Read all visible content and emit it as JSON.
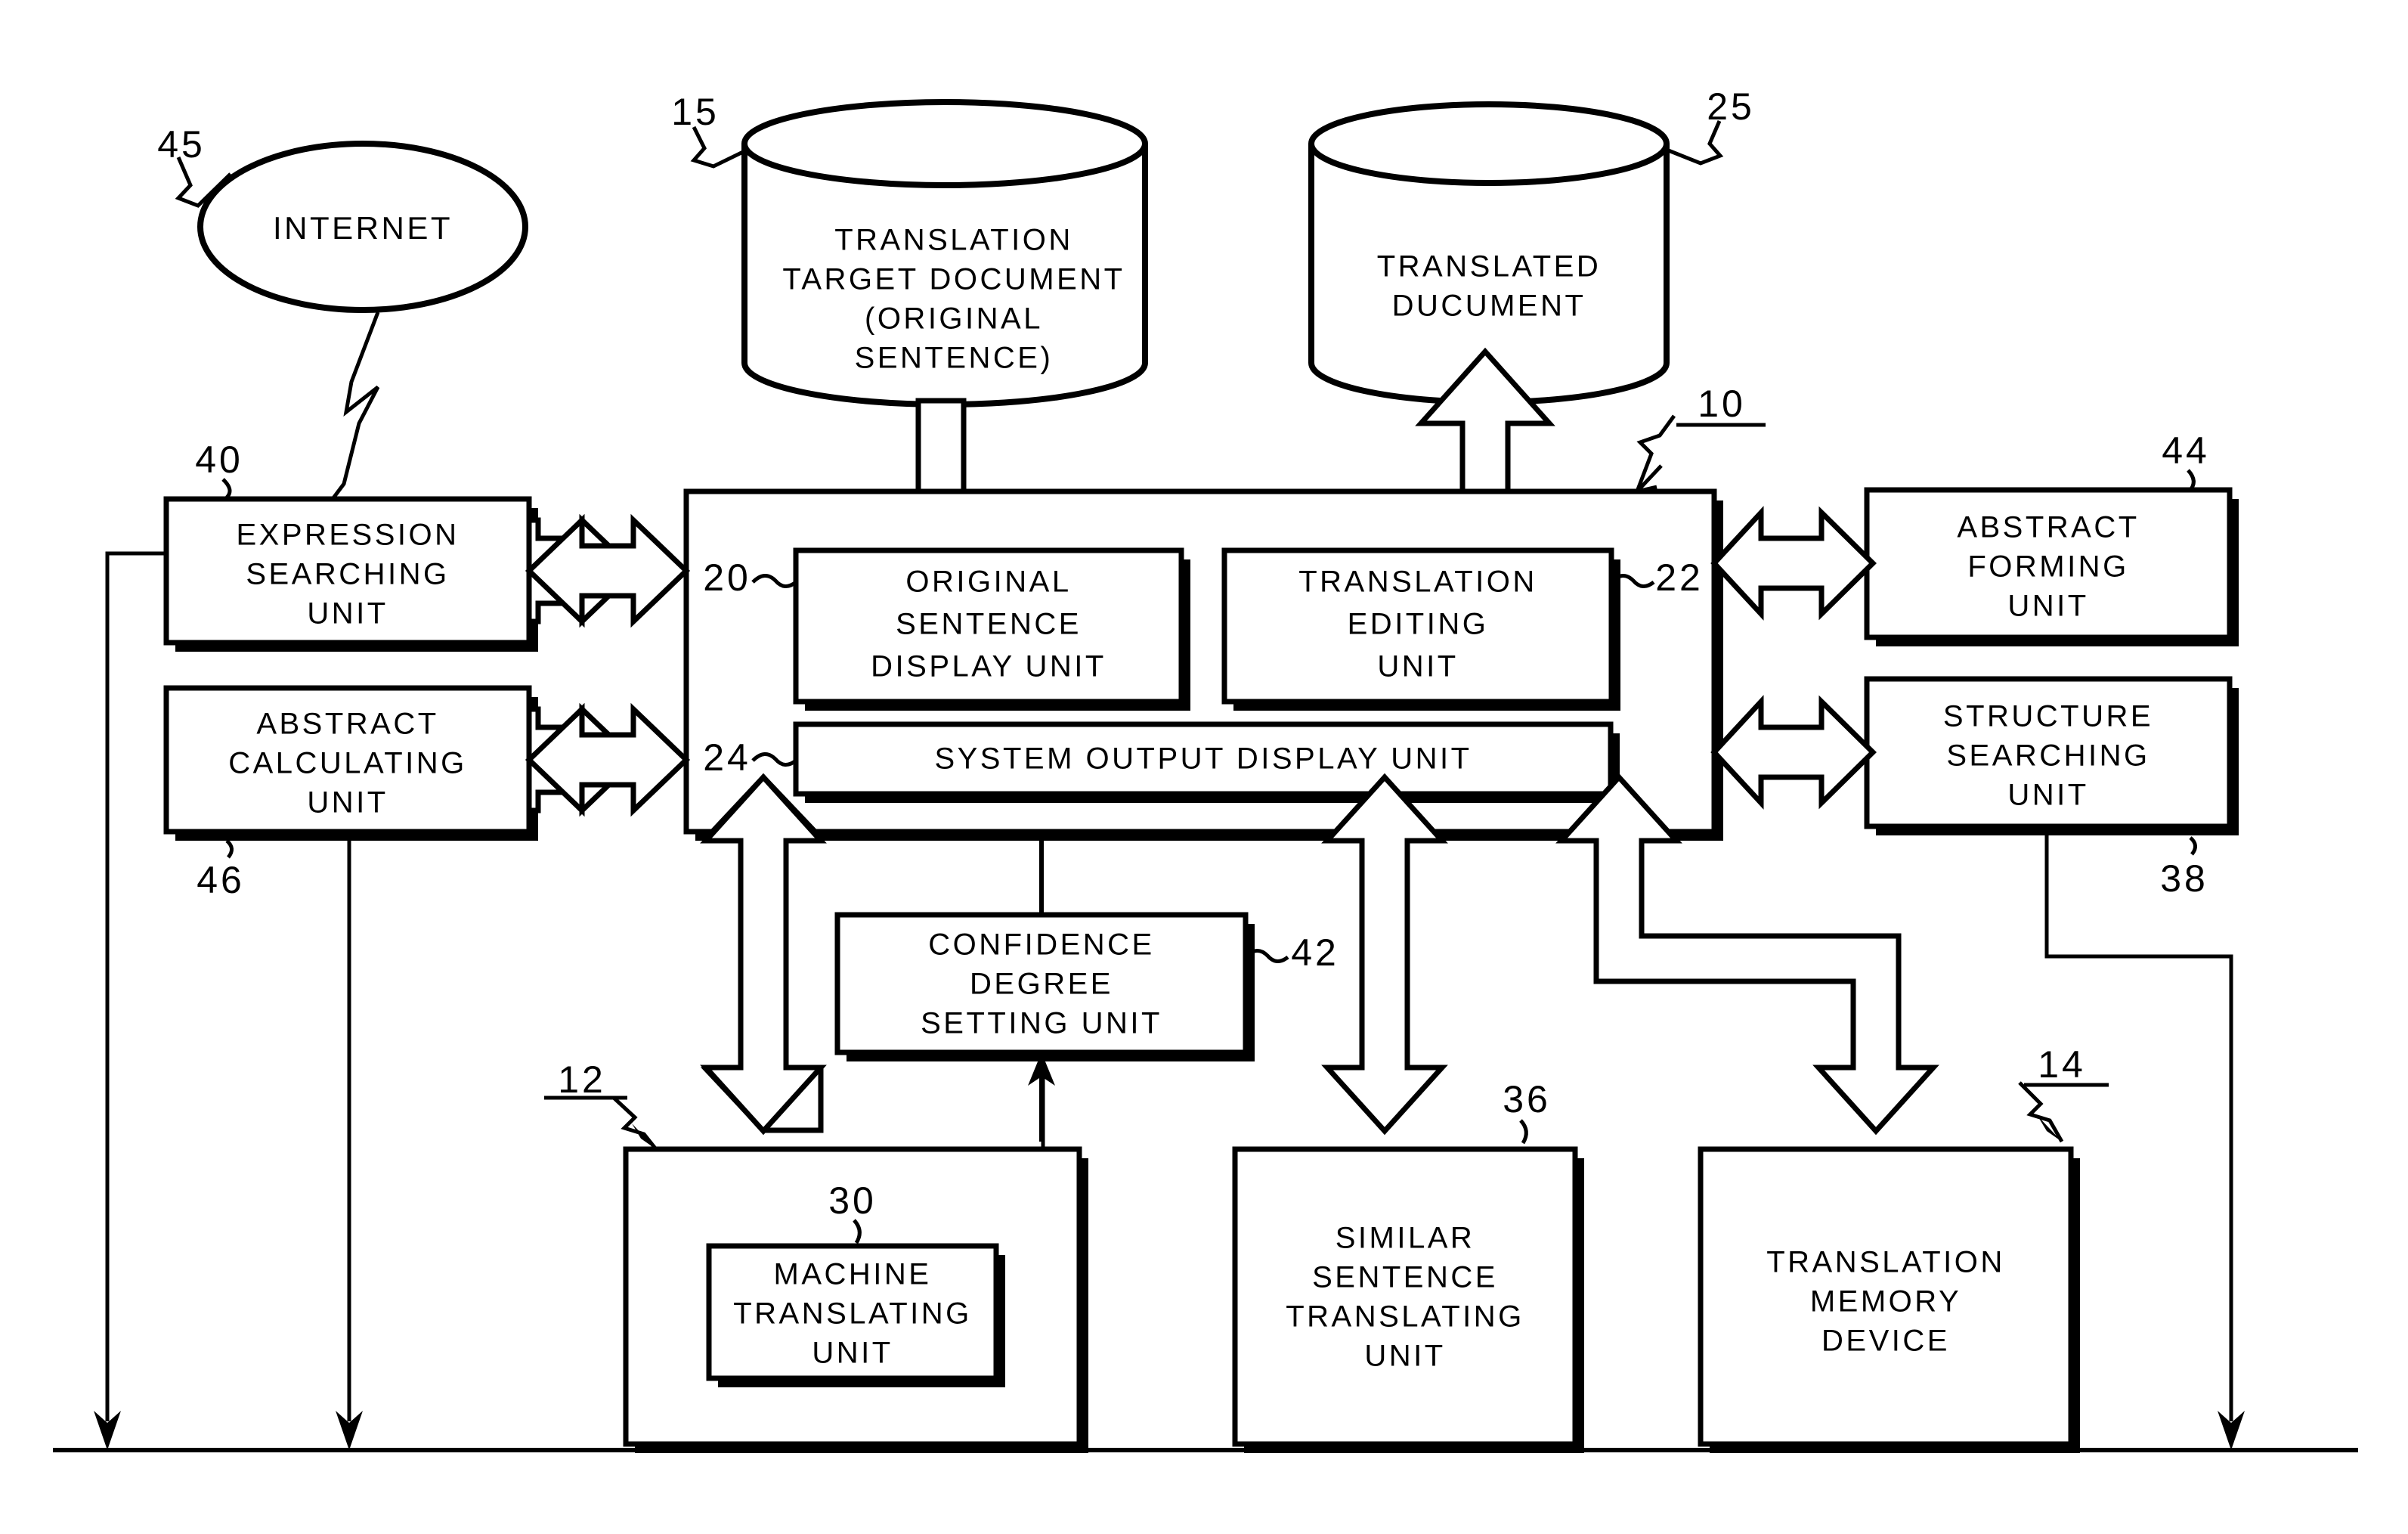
{
  "figure": {
    "type": "patent-block-diagram",
    "title": "Translation support system block diagram"
  },
  "nodes": {
    "internet": {
      "ref": "45",
      "label": "INTERNET",
      "shape": "ellipse"
    },
    "translation_target_document": {
      "ref": "15",
      "shape": "cylinder",
      "lines": [
        "TRANSLATION",
        "TARGET  DOCUMENT",
        "(ORIGINAL",
        "SENTENCE)"
      ]
    },
    "translated_document": {
      "ref": "25",
      "shape": "cylinder",
      "lines": [
        "TRANSLATED",
        "DUCUMENT"
      ]
    },
    "expression_searching_unit": {
      "ref": "40",
      "shape": "box",
      "lines": [
        "EXPRESSION",
        "SEARCHING",
        "UNIT"
      ]
    },
    "abstract_calculating_unit": {
      "ref": "46",
      "shape": "box",
      "lines": [
        "ABSTRACT",
        "CALCULATING",
        "UNIT"
      ]
    },
    "main_unit": {
      "ref": "10",
      "shape": "box"
    },
    "original_sentence_display_unit": {
      "ref": "20",
      "shape": "box",
      "lines": [
        "ORIGINAL",
        "SENTENCE",
        "DISPLAY UNIT"
      ]
    },
    "translation_editing_unit": {
      "ref": "22",
      "shape": "box",
      "lines": [
        "TRANSLATION",
        "EDITING",
        "UNIT"
      ]
    },
    "system_output_display_unit": {
      "ref": "24",
      "shape": "box",
      "lines": [
        "SYSTEM OUTPUT DISPLAY UNIT"
      ]
    },
    "abstract_forming_unit": {
      "ref": "44",
      "shape": "box",
      "lines": [
        "ABSTRACT",
        "FORMING",
        "UNIT"
      ]
    },
    "structure_searching_unit": {
      "ref": "38",
      "shape": "box",
      "lines": [
        "STRUCTURE",
        "SEARCHING",
        "UNIT"
      ]
    },
    "confidence_degree_setting_unit": {
      "ref": "42",
      "shape": "box",
      "lines": [
        "CONFIDENCE",
        "DEGREE",
        "SETTING UNIT"
      ]
    },
    "translating_group": {
      "ref": "12",
      "shape": "box"
    },
    "machine_translating_unit": {
      "ref": "30",
      "shape": "box",
      "lines": [
        "MACHINE",
        "TRANSLATING",
        "UNIT"
      ]
    },
    "similar_sentence_translating_unit": {
      "ref": "36",
      "shape": "box",
      "lines": [
        "SIMILAR",
        "SENTENCE",
        "TRANSLATING",
        "UNIT"
      ]
    },
    "translation_memory_device": {
      "ref": "14",
      "shape": "box",
      "lines": [
        "TRANSLATION",
        "MEMORY",
        "DEVICE"
      ]
    }
  },
  "reference_numerals": {
    "n10": "10",
    "n12": "12",
    "n14": "14",
    "n15": "15",
    "n20": "20",
    "n22": "22",
    "n24": "24",
    "n25": "25",
    "n30": "30",
    "n36": "36",
    "n38": "38",
    "n40": "40",
    "n42": "42",
    "n44": "44",
    "n45": "45",
    "n46": "46"
  },
  "colors": {
    "stroke": "#000000",
    "fill": "#ffffff",
    "background": "#ffffff"
  }
}
